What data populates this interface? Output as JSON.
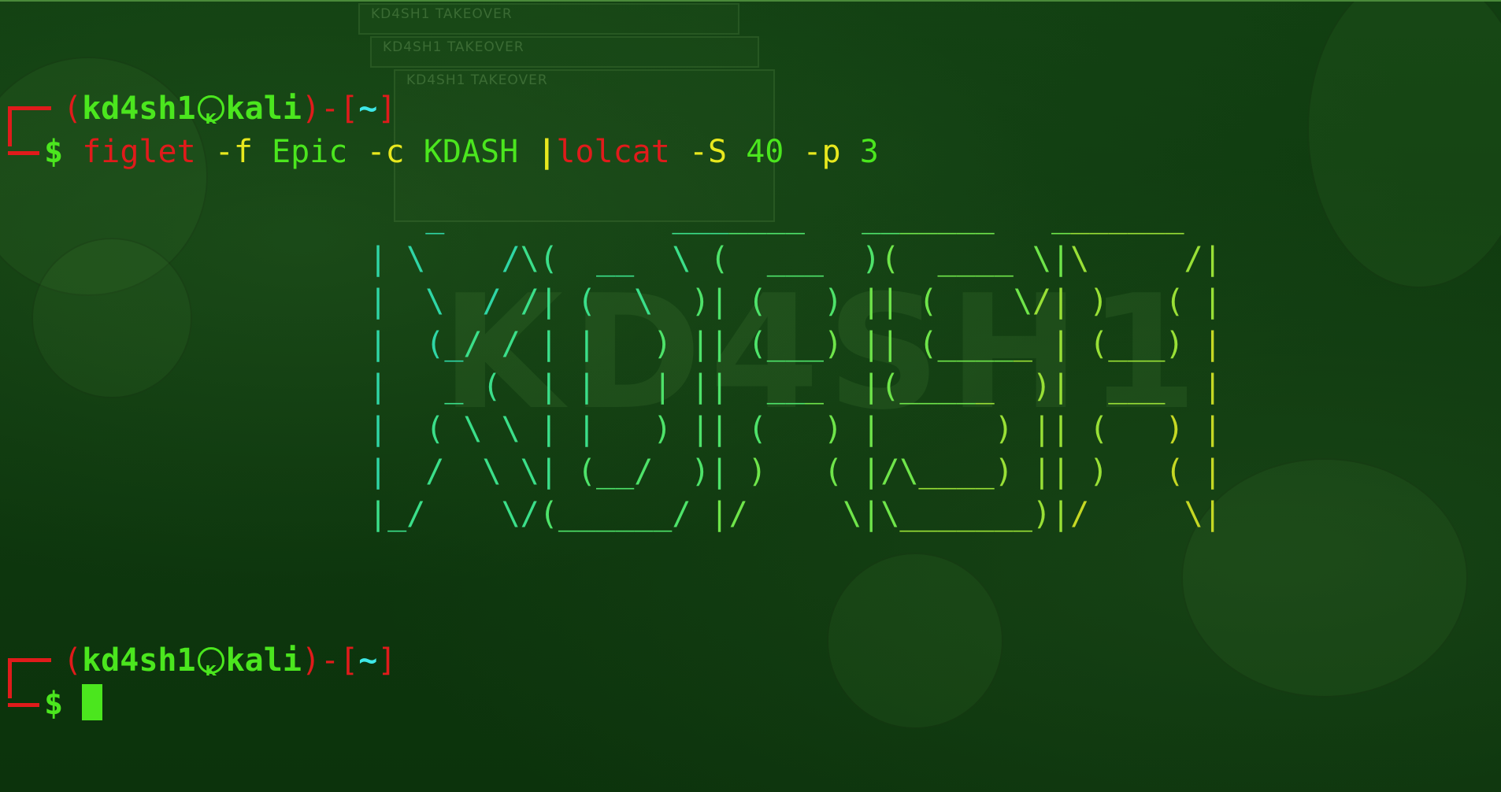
{
  "prompt": {
    "user": "kd4sh1",
    "host": "kali",
    "cwd": "~",
    "open_paren": "(",
    "close_paren": ")",
    "dash": "-",
    "open_bracket": "[",
    "close_bracket": "]",
    "dollar": "$"
  },
  "command": {
    "program": "figlet",
    "flag_f": "-f",
    "font": "Epic",
    "flag_c": "-c",
    "text": "KDASH",
    "pipe": "|",
    "pipe_program": "lolcat",
    "flag_S": "-S",
    "seed": "40",
    "flag_p": "-p",
    "spread": "3"
  },
  "figlet_output": [
    "_            _______   _______   _______",
    "| \\    /\\(  __  \\ (  ___  )(  ____ \\|\\     /|",
    "|  \\  / /| (  \\  )| (   ) || (    \\/| )   ( |",
    "|  (_/ / | |   ) || (___) || (_____ | (___) |",
    "|   _ (  | |   | ||  ___  |(_____  )|  ___  |",
    "|  ( \\ \\ | |   ) || (   ) |      ) || (   ) |",
    "|  /  \\ \\| (__/  )| )   ( |/\\____) || )   ( |",
    "|_/    \\/(______/ |/     \\|\\_______)|/     \\|"
  ],
  "colors": {
    "background": "#0f3a0f",
    "prompt_red": "#e01b1b",
    "prompt_green": "#4be61e",
    "prompt_cyan": "#3ee8e8",
    "arg_yellow": "#e8e81e",
    "figlet_gradient": [
      "#2fd6a6",
      "#3bdf8a",
      "#4ee36a",
      "#6fe54a",
      "#99e036",
      "#c5d824"
    ]
  },
  "icons": {
    "kali_badge": "kali-skull-icon"
  },
  "wallpaper": {
    "window_title": "KD4SH1 TAKEOVER",
    "big_text": "KD4SH1"
  }
}
